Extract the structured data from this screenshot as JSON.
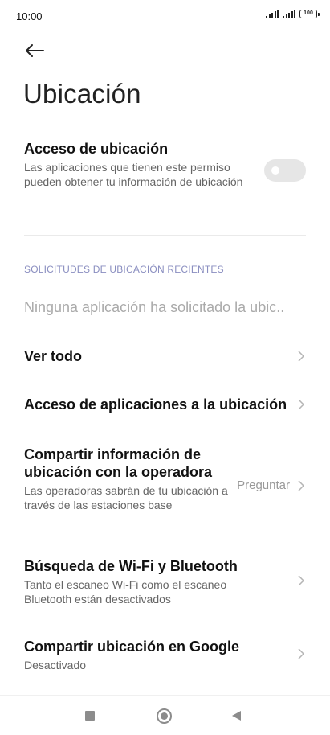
{
  "status_bar": {
    "time": "10:00",
    "battery": "100"
  },
  "header": {
    "title": "Ubicación"
  },
  "location_access": {
    "title": "Acceso de ubicación",
    "description": "Las aplicaciones que tienen este permiso pueden obtener tu información de ubicación",
    "enabled": false
  },
  "recent_requests": {
    "header": "SOLICITUDES DE UBICACIÓN RECIENTES",
    "empty_text": "Ninguna aplicación ha solicitado la ubic.."
  },
  "rows": {
    "see_all": {
      "title": "Ver todo"
    },
    "app_access": {
      "title": "Acceso de aplicaciones a la ubicación"
    },
    "carrier_sharing": {
      "title": "Compartir información de ubicación con la operadora",
      "description": "Las operadoras sabrán de tu ubicación a través de las estaciones base",
      "value": "Preguntar"
    },
    "wifi_bt_scan": {
      "title": "Búsqueda de Wi-Fi y Bluetooth",
      "description": "Tanto el escaneo Wi-Fi como el escaneo Bluetooth están desactivados"
    },
    "google_sharing": {
      "title": "Compartir ubicación en Google",
      "description": "Desactivado"
    }
  },
  "icons": {
    "back": "arrow-left-icon",
    "chevron": "chevron-right-icon",
    "nav_recents": "square-icon",
    "nav_home": "circle-icon",
    "nav_back": "triangle-back-icon"
  }
}
